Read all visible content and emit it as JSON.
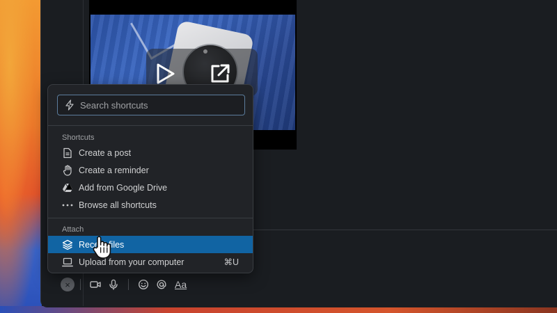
{
  "colors": {
    "accent": "#1164a3",
    "menu_background": "#212327",
    "window_background": "#1a1d21",
    "search_border": "#5c7d9d"
  },
  "video": {
    "icons": [
      "play-icon",
      "open-external-icon"
    ]
  },
  "shortcuts_menu": {
    "search": {
      "icon": "lightning-icon",
      "placeholder": "Search shortcuts"
    },
    "sections": [
      {
        "heading": "Shortcuts",
        "items": [
          {
            "label": "Create a post",
            "icon": "document-icon"
          },
          {
            "label": "Create a reminder",
            "icon": "hand-icon"
          },
          {
            "label": "Add from Google Drive",
            "icon": "google-drive-icon"
          },
          {
            "label": "Browse all shortcuts",
            "icon": "more-dots-icon"
          }
        ]
      },
      {
        "heading": "Attach",
        "items": [
          {
            "label": "Recent files",
            "icon": "layers-icon",
            "selected": true
          },
          {
            "label": "Upload from your computer",
            "icon": "laptop-icon",
            "shortcut": "⌘U"
          }
        ]
      }
    ]
  },
  "composer": {
    "close_symbol": "×",
    "toolbar_icons": [
      "video-camera-icon",
      "microphone-icon",
      "emoji-icon",
      "mention-icon"
    ],
    "format_label": "Aa"
  }
}
